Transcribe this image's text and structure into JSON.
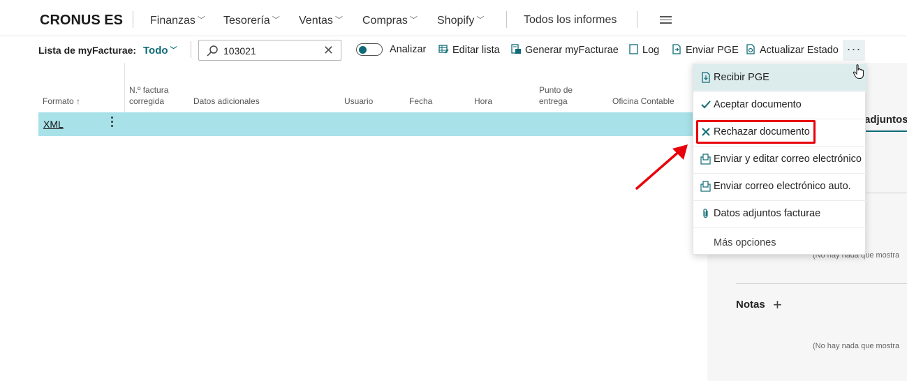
{
  "topnav": {
    "brand": "CRONUS ES",
    "items": [
      {
        "label": "Finanzas",
        "has_chevron": true
      },
      {
        "label": "Tesorería",
        "has_chevron": true
      },
      {
        "label": "Ventas",
        "has_chevron": true
      },
      {
        "label": "Compras",
        "has_chevron": true
      },
      {
        "label": "Shopify",
        "has_chevron": true
      },
      {
        "label": "Todos los informes",
        "has_chevron": false
      }
    ],
    "menu_icon": "hamburger-icon"
  },
  "actionbar": {
    "list_label": "Lista de myFacturae:",
    "filter_value": "Todo",
    "search": {
      "value": "103021",
      "icon": "search-icon",
      "clear_icon": "close-icon"
    },
    "toggle": {
      "label": "Analizar",
      "on": true
    },
    "actions": [
      {
        "label": "Editar lista",
        "icon": "edit-list-icon"
      },
      {
        "label": "Generar myFacturae",
        "icon": "generate-doc-icon"
      },
      {
        "label": "Log",
        "icon": "log-icon"
      },
      {
        "label": "Enviar PGE",
        "icon": "send-doc-icon"
      },
      {
        "label": "Actualizar Estado",
        "icon": "update-doc-icon"
      }
    ],
    "more": "···"
  },
  "grid": {
    "columns": [
      {
        "label": "Formato ↑"
      },
      {
        "label1": "N.º factura",
        "label2": "corregida"
      },
      {
        "label": "Datos adicionales"
      },
      {
        "label": "Usuario"
      },
      {
        "label": "Fecha"
      },
      {
        "label": "Hora"
      },
      {
        "label1": "Punto de",
        "label2": "entrega"
      },
      {
        "label": "Oficina Contable"
      }
    ],
    "rows": [
      {
        "formato": "XML"
      }
    ]
  },
  "menu": {
    "items": [
      {
        "label": "Recibir PGE",
        "icon": "receive-doc-icon",
        "highlighted": true
      },
      {
        "label": "Aceptar documento",
        "icon": "checkmark-icon"
      },
      {
        "label": "Rechazar documento",
        "icon": "x-icon"
      },
      {
        "label": "Enviar y editar correo electrónico",
        "icon": "email-doc-icon"
      },
      {
        "label": "Enviar correo electrónico auto.",
        "icon": "email-doc-icon"
      },
      {
        "label": "Datos adjuntos facturae",
        "icon": "paperclip-icon"
      }
    ],
    "more_options": "Más opciones"
  },
  "rightpanel": {
    "tab_label": "adjuntos",
    "empty_text_1": "(No hay nada que mostra",
    "notes_label": "Notas",
    "empty_text_2": "(No hay nada que mostra"
  },
  "colors": {
    "accent": "#0f6b76",
    "row_selected": "#a9e1e8",
    "menu_highlight": "#dcebec",
    "annotation_red": "#e8000b"
  }
}
